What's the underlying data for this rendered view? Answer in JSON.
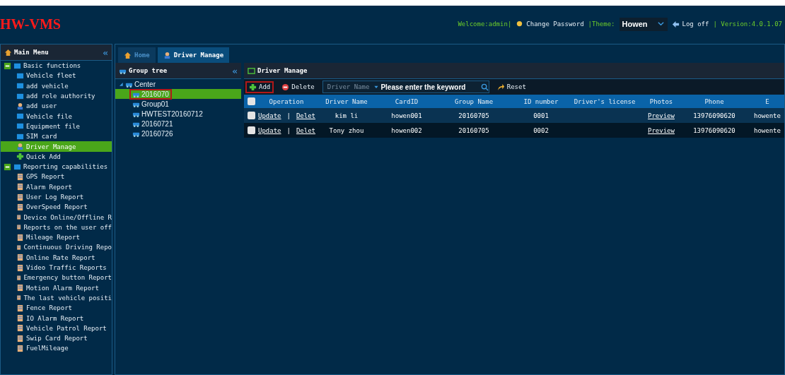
{
  "header": {
    "logo": "HW-VMS",
    "welcome": "Welcome:admin|",
    "change_password": "Change Password",
    "theme_label": "|Theme:",
    "theme_value": "Howen",
    "logoff": "Log off",
    "version": "| Version:4.0.1.07"
  },
  "sidebar": {
    "title": "Main Menu",
    "collapse": "«",
    "items": [
      {
        "label": "Basic functions",
        "expanded": true,
        "children": [
          {
            "label": "Vehicle fleet",
            "selected": false
          },
          {
            "label": "add vehicle",
            "selected": false
          },
          {
            "label": "add role authority",
            "selected": false
          },
          {
            "label": "add user",
            "selected": false
          },
          {
            "label": "Vehicle file",
            "selected": false
          },
          {
            "label": "Equipment file",
            "selected": false
          },
          {
            "label": "SIM card",
            "selected": false
          },
          {
            "label": "Driver Manage",
            "selected": true
          },
          {
            "label": "Quick Add",
            "selected": false
          }
        ]
      },
      {
        "label": "Reporting capabilities",
        "expanded": true,
        "children": [
          {
            "label": "GPS Report",
            "selected": false
          },
          {
            "label": "Alarm Report",
            "selected": false
          },
          {
            "label": "User Log Report",
            "selected": false
          },
          {
            "label": "OverSpeed Report",
            "selected": false
          },
          {
            "label": "Device Online/Offline R",
            "selected": false
          },
          {
            "label": "Reports on the user off",
            "selected": false
          },
          {
            "label": "Mileage Report",
            "selected": false
          },
          {
            "label": "Continuous Driving Repo",
            "selected": false
          },
          {
            "label": "Online Rate Report",
            "selected": false
          },
          {
            "label": "Video Traffic Reports",
            "selected": false
          },
          {
            "label": "Emergency button Report",
            "selected": false
          },
          {
            "label": "Motion Alarm Report",
            "selected": false
          },
          {
            "label": "The last vehicle positi",
            "selected": false
          },
          {
            "label": "Fence Report",
            "selected": false
          },
          {
            "label": "IO Alarm Report",
            "selected": false
          },
          {
            "label": "Vehicle Patrol Report",
            "selected": false
          },
          {
            "label": "Swip Card Report",
            "selected": false
          },
          {
            "label": "FuelMileage",
            "selected": false
          }
        ]
      }
    ]
  },
  "tabs": [
    {
      "label": "Home",
      "selected": false
    },
    {
      "label": "Driver Manage",
      "selected": true
    }
  ],
  "group_tree": {
    "title": "Group tree",
    "collapse": "«",
    "root": {
      "label": "Center",
      "expanded": true,
      "children": [
        {
          "label": "2016070",
          "selected": true,
          "highlighted": true
        },
        {
          "label": "Group01",
          "selected": false,
          "highlighted": false
        },
        {
          "label": "HWTEST20160712",
          "selected": false,
          "highlighted": false
        },
        {
          "label": "20160721",
          "selected": false,
          "highlighted": false
        },
        {
          "label": "20160726",
          "selected": false,
          "highlighted": false
        }
      ]
    }
  },
  "panel": {
    "title": "Driver Manage",
    "toolbar": {
      "add": "Add",
      "add_highlighted": true,
      "delete": "Delete",
      "filter": "Driver Name",
      "search_placeholder": "Please enter the keyword",
      "reset": "Reset"
    },
    "table": {
      "all_checked": false,
      "operation_column": "Operation",
      "columns": [
        "Driver Name",
        "CardID",
        "Group Name",
        "ID number",
        "Driver's license",
        "Photos",
        "Phone",
        "E"
      ],
      "rows": [
        {
          "checked": false,
          "update": "Update",
          "sep": "|",
          "delete": "Delet",
          "cells": [
            "kim li",
            "howen001",
            "20160705",
            "0001",
            "",
            "Preview",
            "13976090620",
            "howente"
          ]
        },
        {
          "checked": false,
          "update": "Update",
          "sep": "|",
          "delete": "Delet",
          "cells": [
            "Tony zhou",
            "howen002",
            "20160705",
            "0002",
            "",
            "Preview",
            "13976090620",
            "howente"
          ]
        }
      ]
    }
  }
}
